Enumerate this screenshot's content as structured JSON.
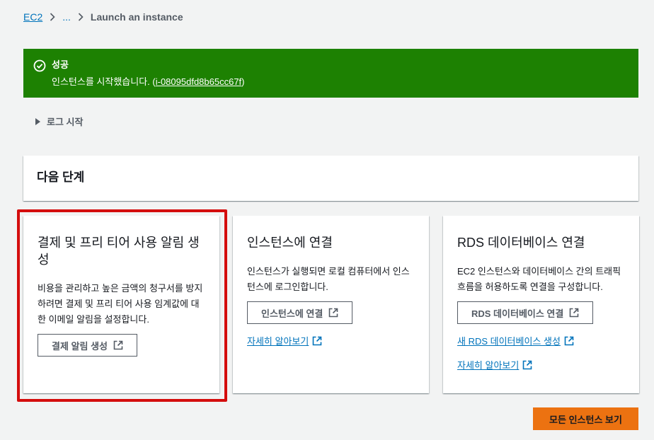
{
  "breadcrumb": {
    "root": "EC2",
    "ellipsis": "...",
    "current": "Launch an instance"
  },
  "flash": {
    "title": "성공",
    "message_prefix": "인스턴스를 시작했습니다. (",
    "instance_id": "i-08095dfd8b65cc67f",
    "message_suffix": ")",
    "icon": "check-circle-icon",
    "color": "#1d8102"
  },
  "log_toggle": {
    "label": "로그 시작",
    "icon": "caret-right-icon"
  },
  "next_steps": {
    "title": "다음 단계"
  },
  "cards": [
    {
      "title": "결제 및 프리 티어 사용 알림 생성",
      "description": "비용을 관리하고 높은 금액의 청구서를 방지하려면 결제 및 프리 티어 사용 임계값에 대한 이메일 알림을 설정합니다.",
      "button": "결제 알림 생성",
      "highlighted": true
    },
    {
      "title": "인스턴스에 연결",
      "description": "인스턴스가 실행되면 로컬 컴퓨터에서 인스턴스에 로그인합니다.",
      "button": "인스턴스에 연결",
      "link": "자세히 알아보기"
    },
    {
      "title": "RDS 데이터베이스 연결",
      "description": "EC2 인스턴스와 데이터베이스 간의 트래픽 흐름을 허용하도록 연결을 구성합니다.",
      "button": "RDS 데이터베이스 연결",
      "link1": "새 RDS 데이터베이스 생성",
      "link2": "자세히 알아보기"
    }
  ],
  "primary_button": {
    "label": "모든 인스턴스 보기",
    "color": "#ec7211"
  },
  "colors": {
    "link": "#0073bb",
    "highlight_border": "#d40d0d",
    "background": "#f2f3f3"
  }
}
